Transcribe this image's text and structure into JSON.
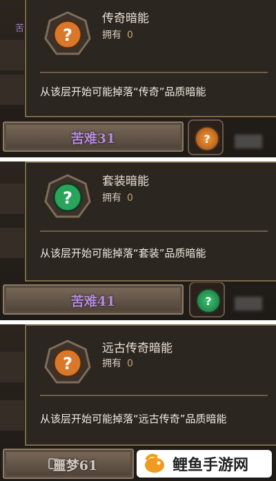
{
  "panels": [
    {
      "tooltip": {
        "title": "传奇暗能",
        "own_label": "拥有",
        "own_count": "0",
        "description": "从该层开始可能掉落“传奇”品质暗能",
        "gem": "orange-gem-icon"
      },
      "floor_label": "苦难31",
      "bg_partial": "苦难"
    },
    {
      "tooltip": {
        "title": "套装暗能",
        "own_label": "拥有",
        "own_count": "0",
        "description": "从该层开始可能掉落“套装”品质暗能",
        "gem": "green-gem-icon"
      },
      "floor_label": "苦难41"
    },
    {
      "tooltip": {
        "title": "远古传奇暗能",
        "own_label": "拥有",
        "own_count": "0",
        "description": "从该层开始可能掉落“远古传奇”品质暗能",
        "gem": "orange-gem-icon"
      },
      "floor_label": "噩梦61"
    }
  ],
  "watermark": {
    "text": "鲤鱼手游网"
  },
  "colors": {
    "orange": "#d9772a",
    "green": "#2aa35b",
    "purple": "#b48cd8"
  }
}
